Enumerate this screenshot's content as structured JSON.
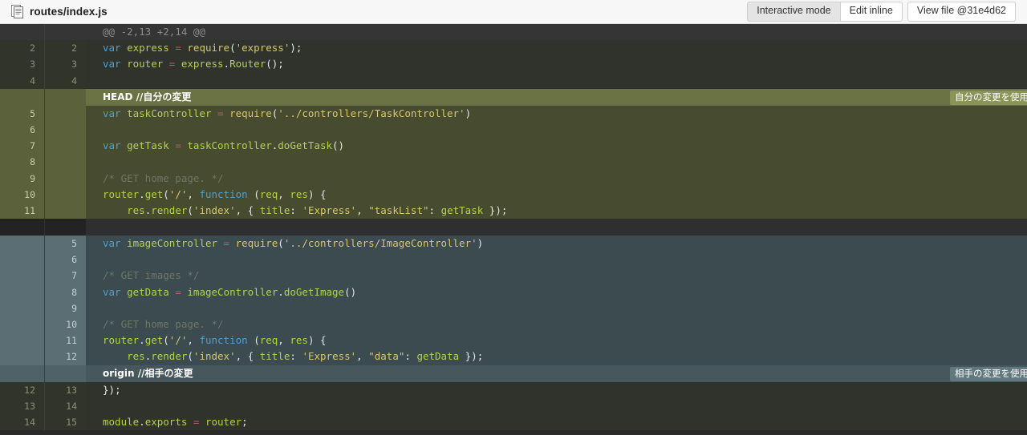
{
  "header": {
    "file_icon": "file-document-icon",
    "file_name": "routes/index.js",
    "buttons": {
      "interactive_mode": "Interactive mode",
      "edit_inline": "Edit inline",
      "view_file": "View file @31e4d62"
    }
  },
  "diff": {
    "hunk_header": "@@ -2,13 +2,14 @@",
    "conflict": {
      "ours_marker": "HEAD //自分の変更",
      "ours_resolve_label": "自分の変更を使用",
      "theirs_marker": "origin //相手の変更",
      "theirs_resolve_label": "相手の変更を使用"
    },
    "rows": [
      {
        "kind": "hunk",
        "old": "",
        "new": "",
        "text": "@@ -2,13 +2,14 @@"
      },
      {
        "kind": "ctx",
        "old": "2",
        "new": "2",
        "text": "var express = require('express');"
      },
      {
        "kind": "ctx",
        "old": "3",
        "new": "3",
        "text": "var router = express.Router();"
      },
      {
        "kind": "ctx",
        "old": "4",
        "new": "4",
        "text": ""
      },
      {
        "kind": "marker-ours",
        "old": "",
        "new": "",
        "text": "HEAD //自分の変更"
      },
      {
        "kind": "ours",
        "old": "5",
        "new": "",
        "text": "var taskController = require('../controllers/TaskController')"
      },
      {
        "kind": "ours",
        "old": "6",
        "new": "",
        "text": ""
      },
      {
        "kind": "ours",
        "old": "7",
        "new": "",
        "text": "var getTask = taskController.doGetTask()"
      },
      {
        "kind": "ours",
        "old": "8",
        "new": "",
        "text": ""
      },
      {
        "kind": "ours",
        "old": "9",
        "new": "",
        "text": "/* GET home page. */"
      },
      {
        "kind": "ours",
        "old": "10",
        "new": "",
        "text": "router.get('/', function (req, res) {"
      },
      {
        "kind": "ours",
        "old": "11",
        "new": "",
        "text": "    res.render('index', { title: 'Express', \"taskList\": getTask });"
      },
      {
        "kind": "sep",
        "old": "",
        "new": "",
        "text": ""
      },
      {
        "kind": "theirs",
        "old": "",
        "new": "5",
        "text": "var imageController = require('../controllers/ImageController')"
      },
      {
        "kind": "theirs",
        "old": "",
        "new": "6",
        "text": ""
      },
      {
        "kind": "theirs",
        "old": "",
        "new": "7",
        "text": "/* GET images */"
      },
      {
        "kind": "theirs",
        "old": "",
        "new": "8",
        "text": "var getData = imageController.doGetImage()"
      },
      {
        "kind": "theirs",
        "old": "",
        "new": "9",
        "text": ""
      },
      {
        "kind": "theirs",
        "old": "",
        "new": "10",
        "text": "/* GET home page. */"
      },
      {
        "kind": "theirs",
        "old": "",
        "new": "11",
        "text": "router.get('/', function (req, res) {"
      },
      {
        "kind": "theirs",
        "old": "",
        "new": "12",
        "text": "    res.render('index', { title: 'Express', \"data\": getData });"
      },
      {
        "kind": "marker-theirs",
        "old": "",
        "new": "",
        "text": "origin //相手の変更"
      },
      {
        "kind": "ctx",
        "old": "12",
        "new": "13",
        "text": "});"
      },
      {
        "kind": "ctx",
        "old": "13",
        "new": "14",
        "text": ""
      },
      {
        "kind": "ctx",
        "old": "14",
        "new": "15",
        "text": "module.exports = router;"
      }
    ]
  },
  "colors": {
    "ours_bg": "#474b30",
    "ours_gutter": "#5b613a",
    "theirs_bg": "#3b4b50",
    "theirs_gutter": "#5b6e74",
    "context_bg": "#2f332c",
    "keyword": "#4f9fd4",
    "identifier": "#b4d24a",
    "string": "#d7c76a",
    "operator": "#c05a68",
    "comment": "#6f7566"
  }
}
